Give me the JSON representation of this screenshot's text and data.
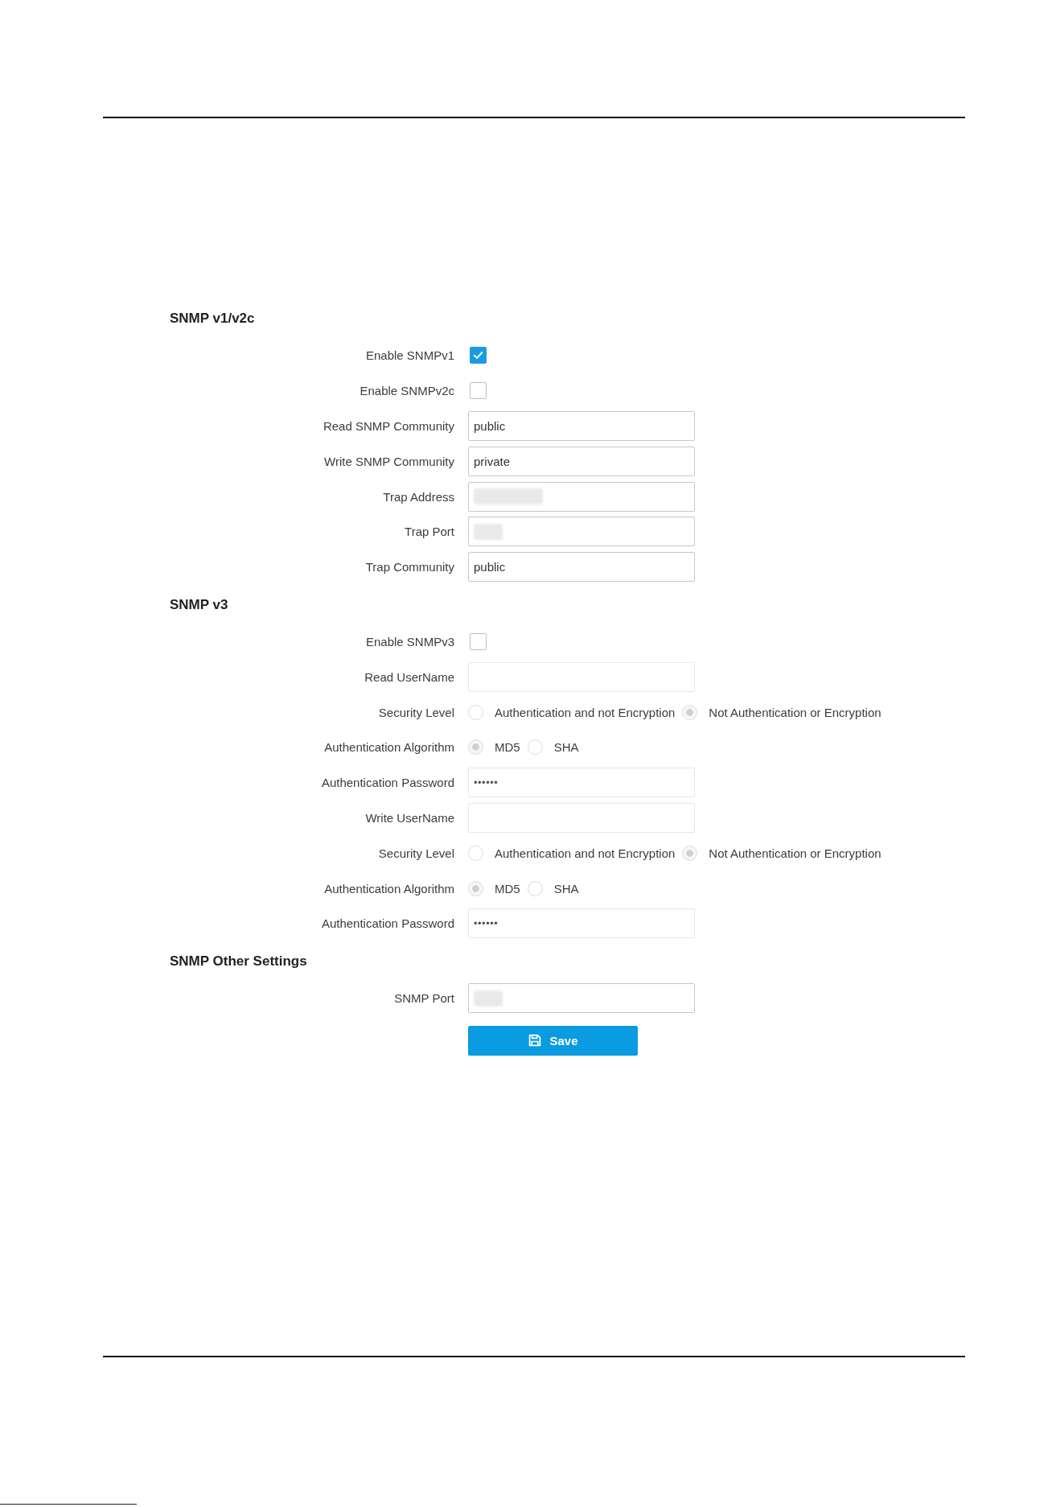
{
  "sections": [
    {
      "title": "SNMP v1/v2c",
      "rows": [
        {
          "kind": "checkbox",
          "label": "Enable SNMPv1",
          "checked": true
        },
        {
          "kind": "checkbox",
          "label": "Enable SNMPv2c",
          "checked": false
        },
        {
          "kind": "text",
          "label": "Read SNMP Community",
          "value": "public",
          "disabled": false
        },
        {
          "kind": "text",
          "label": "Write SNMP Community",
          "value": "private",
          "disabled": false
        },
        {
          "kind": "address",
          "label": "Trap Address",
          "blurred": true,
          "disabled": false
        },
        {
          "kind": "port",
          "label": "Trap Port",
          "blurred": true,
          "disabled": false
        },
        {
          "kind": "text",
          "label": "Trap Community",
          "value": "public",
          "disabled": false
        }
      ]
    },
    {
      "title": "SNMP v3",
      "rows": [
        {
          "kind": "checkbox",
          "label": "Enable SNMPv3",
          "checked": false
        },
        {
          "kind": "text",
          "label": "Read UserName",
          "disabled": true
        },
        {
          "kind": "radio",
          "label": "Security Level",
          "disabled": true,
          "options": [
            {
              "label": "Authentication and not Encryption",
              "selected": false
            },
            {
              "label": "Not Authentication or Encryption",
              "selected": true
            }
          ]
        },
        {
          "kind": "radio",
          "label": "Authentication Algorithm",
          "disabled": true,
          "options": [
            {
              "label": "MD5",
              "selected": true
            },
            {
              "label": "SHA",
              "selected": false
            }
          ]
        },
        {
          "kind": "password",
          "label": "Authentication Password",
          "value": "••••••",
          "disabled": true
        },
        {
          "kind": "text",
          "label": "Write UserName",
          "disabled": true
        },
        {
          "kind": "radio",
          "label": "Security Level",
          "disabled": true,
          "options": [
            {
              "label": "Authentication and not Encryption",
              "selected": false
            },
            {
              "label": "Not Authentication or Encryption",
              "selected": true
            }
          ]
        },
        {
          "kind": "radio",
          "label": "Authentication Algorithm",
          "disabled": true,
          "options": [
            {
              "label": "MD5",
              "selected": true
            },
            {
              "label": "SHA",
              "selected": false
            }
          ]
        },
        {
          "kind": "password",
          "label": "Authentication Password",
          "value": "••••••",
          "disabled": true
        }
      ]
    },
    {
      "title": "SNMP Other Settings",
      "rows": [
        {
          "kind": "port",
          "label": "SNMP Port",
          "blurred": true,
          "disabled": false
        }
      ]
    }
  ],
  "save_button": {
    "label": "Save"
  }
}
